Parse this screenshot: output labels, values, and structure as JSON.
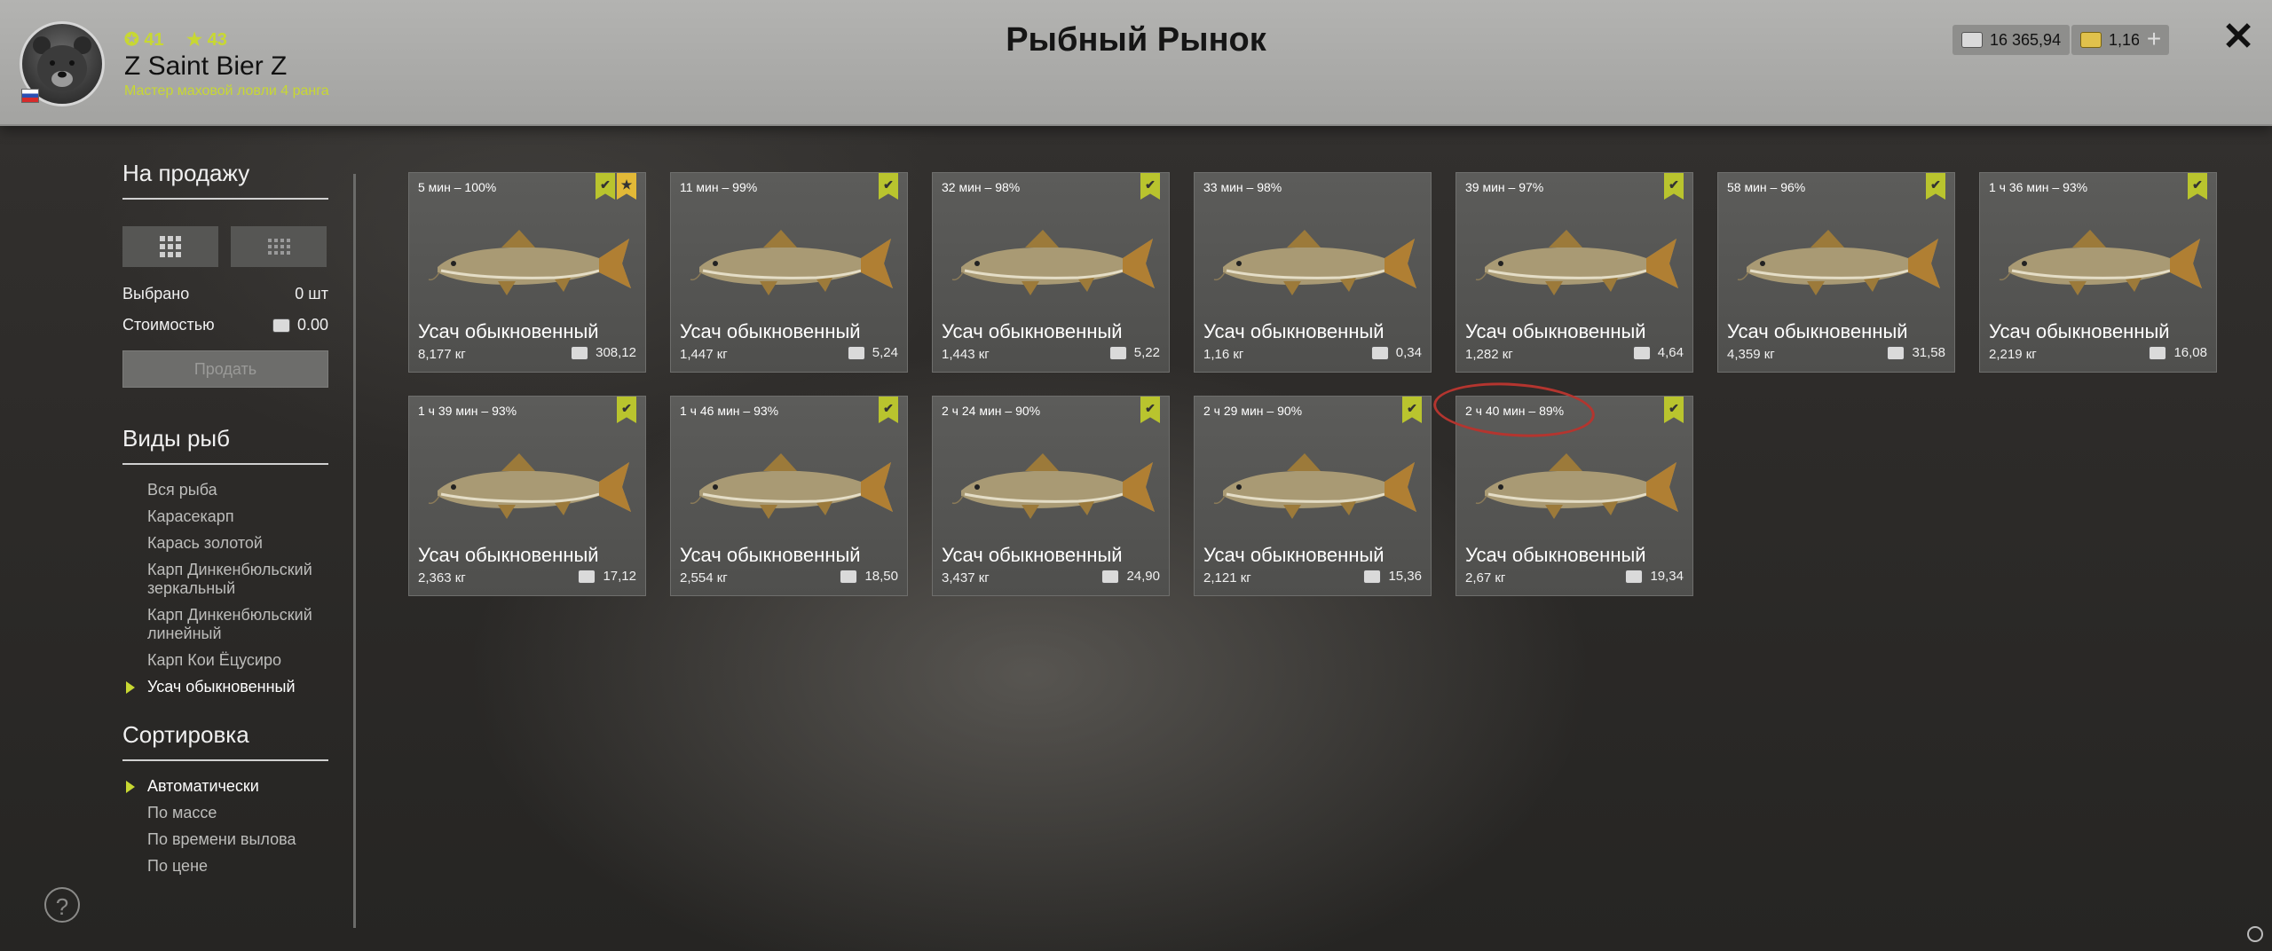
{
  "header": {
    "title": "Рыбный Рынок",
    "player": {
      "name": "Z Saint Bier Z",
      "rank": "Мастер маховой ловли 4 ранга",
      "level": "41",
      "stars": "43"
    },
    "silver": "16 365,94",
    "gold": "1,16",
    "plus_label": "+",
    "close_label": "✕"
  },
  "sidebar": {
    "for_sale": {
      "title": "На продажу",
      "selected_label": "Выбрано",
      "selected_value": "0 шт",
      "cost_label": "Стоимостью",
      "cost_value": "0.00",
      "sell_label": "Продать"
    },
    "fish_types": {
      "title": "Виды рыб",
      "items": [
        {
          "label": "Вся рыба",
          "active": false
        },
        {
          "label": "Карасекарп",
          "active": false
        },
        {
          "label": "Карась золотой",
          "active": false
        },
        {
          "label": "Карп Динкенбюльский зеркальный",
          "active": false
        },
        {
          "label": "Карп Динкенбюльский линейный",
          "active": false
        },
        {
          "label": "Карп Кои Ёцусиро",
          "active": false
        },
        {
          "label": "Усач обыкновенный",
          "active": true
        }
      ]
    },
    "sort": {
      "title": "Сортировка",
      "items": [
        {
          "label": "Автоматически",
          "active": true
        },
        {
          "label": "По массе",
          "active": false
        },
        {
          "label": "По времени вылова",
          "active": false
        },
        {
          "label": "По цене",
          "active": false
        }
      ]
    },
    "help_label": "?"
  },
  "cards": [
    {
      "caught": "5 мин – 100%",
      "name": "Усач обыкновенный",
      "weight": "8,177 кг",
      "price": "308,12",
      "checked": true,
      "star": true
    },
    {
      "caught": "11 мин – 99%",
      "name": "Усач обыкновенный",
      "weight": "1,447 кг",
      "price": "5,24",
      "checked": true,
      "star": false
    },
    {
      "caught": "32 мин – 98%",
      "name": "Усач обыкновенный",
      "weight": "1,443 кг",
      "price": "5,22",
      "checked": true,
      "star": false
    },
    {
      "caught": "33 мин – 98%",
      "name": "Усач обыкновенный",
      "weight": "1,16 кг",
      "price": "0,34",
      "checked": false,
      "star": false
    },
    {
      "caught": "39 мин – 97%",
      "name": "Усач обыкновенный",
      "weight": "1,282 кг",
      "price": "4,64",
      "checked": true,
      "star": false
    },
    {
      "caught": "58 мин – 96%",
      "name": "Усач обыкновенный",
      "weight": "4,359 кг",
      "price": "31,58",
      "checked": true,
      "star": false
    },
    {
      "caught": "1 ч 36 мин – 93%",
      "name": "Усач обыкновенный",
      "weight": "2,219 кг",
      "price": "16,08",
      "checked": true,
      "star": false
    },
    {
      "caught": "1 ч 39 мин – 93%",
      "name": "Усач обыкновенный",
      "weight": "2,363 кг",
      "price": "17,12",
      "checked": true,
      "star": false
    },
    {
      "caught": "1 ч 46 мин – 93%",
      "name": "Усач обыкновенный",
      "weight": "2,554 кг",
      "price": "18,50",
      "checked": true,
      "star": false
    },
    {
      "caught": "2 ч 24 мин – 90%",
      "name": "Усач обыкновенный",
      "weight": "3,437 кг",
      "price": "24,90",
      "checked": true,
      "star": false
    },
    {
      "caught": "2 ч 29 мин – 90%",
      "name": "Усач обыкновенный",
      "weight": "2,121 кг",
      "price": "15,36",
      "checked": true,
      "star": false
    },
    {
      "caught": "2 ч 40 мин – 89%",
      "name": "Усач обыкновенный",
      "weight": "2,67 кг",
      "price": "19,34",
      "checked": true,
      "star": false
    }
  ],
  "colors": {
    "accent": "#c8d832",
    "badge": "#b9c42e",
    "star_badge": "#e2b937",
    "highlight_circle": "#b4352f"
  }
}
